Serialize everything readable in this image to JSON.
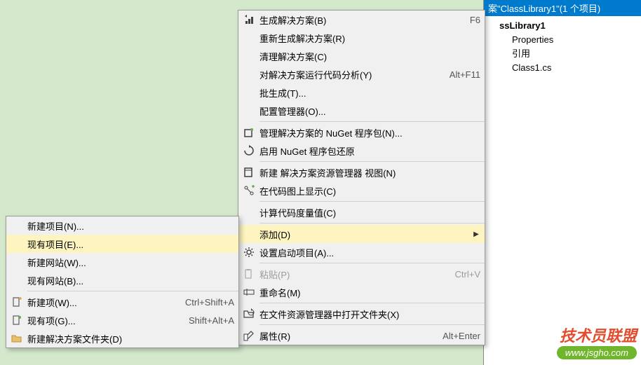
{
  "solution": {
    "header": "案\"ClassLibrary1\"(1 个项目)",
    "project": "ssLibrary1",
    "properties": "Properties",
    "references": "引用",
    "class_file": "Class1.cs"
  },
  "main_menu": [
    {
      "icon": "build",
      "label": "生成解决方案(B)",
      "shortcut": "F6"
    },
    {
      "label": "重新生成解决方案(R)"
    },
    {
      "label": "清理解决方案(C)"
    },
    {
      "label": "对解决方案运行代码分析(Y)",
      "shortcut": "Alt+F11"
    },
    {
      "label": "批生成(T)..."
    },
    {
      "label": "配置管理器(O)..."
    },
    {
      "sep": true
    },
    {
      "icon": "nuget",
      "label": "管理解决方案的 NuGet 程序包(N)..."
    },
    {
      "icon": "restore",
      "label": "启用 NuGet 程序包还原"
    },
    {
      "sep": true
    },
    {
      "icon": "newview",
      "label": "新建 解决方案资源管理器 视图(N)"
    },
    {
      "icon": "codemap",
      "label": "在代码图上显示(C)"
    },
    {
      "sep": true
    },
    {
      "label": "计算代码度量值(C)"
    },
    {
      "sep": true
    },
    {
      "label": "添加(D)",
      "hover": true,
      "submenu": true
    },
    {
      "icon": "gear",
      "label": "设置启动项目(A)..."
    },
    {
      "sep": true
    },
    {
      "icon": "paste",
      "label": "粘贴(P)",
      "shortcut": "Ctrl+V",
      "disabled": true
    },
    {
      "icon": "rename",
      "label": "重命名(M)"
    },
    {
      "sep": true
    },
    {
      "icon": "openfolder",
      "label": "在文件资源管理器中打开文件夹(X)"
    },
    {
      "sep": true
    },
    {
      "icon": "props",
      "label": "属性(R)",
      "shortcut": "Alt+Enter"
    }
  ],
  "sub_menu": [
    {
      "label": "新建项目(N)..."
    },
    {
      "label": "现有项目(E)...",
      "hover": true
    },
    {
      "label": "新建网站(W)..."
    },
    {
      "label": "现有网站(B)..."
    },
    {
      "sep": true
    },
    {
      "icon": "newitem",
      "label": "新建项(W)...",
      "shortcut": "Ctrl+Shift+A"
    },
    {
      "icon": "existitem",
      "label": "现有项(G)...",
      "shortcut": "Shift+Alt+A"
    },
    {
      "icon": "folder",
      "label": "新建解决方案文件夹(D)"
    }
  ],
  "watermark": {
    "line1": "技术员联盟",
    "line2": "www.jsgho.com"
  }
}
